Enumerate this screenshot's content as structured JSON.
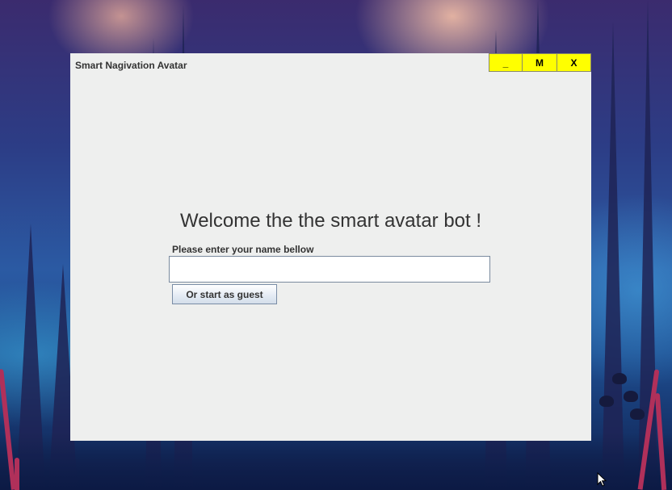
{
  "window": {
    "title": "Smart Nagivation Avatar",
    "controls": {
      "minimize_label": "_",
      "maximize_label": "M",
      "close_label": "X",
      "color": "#ffff00"
    }
  },
  "main": {
    "heading": "Welcome the the smart avatar bot !",
    "name_label": "Please enter your name bellow",
    "name_input": {
      "value": "",
      "placeholder": ""
    },
    "guest_button_label": "Or start as guest"
  },
  "icons": {
    "cursor": "mouse-pointer-icon"
  }
}
